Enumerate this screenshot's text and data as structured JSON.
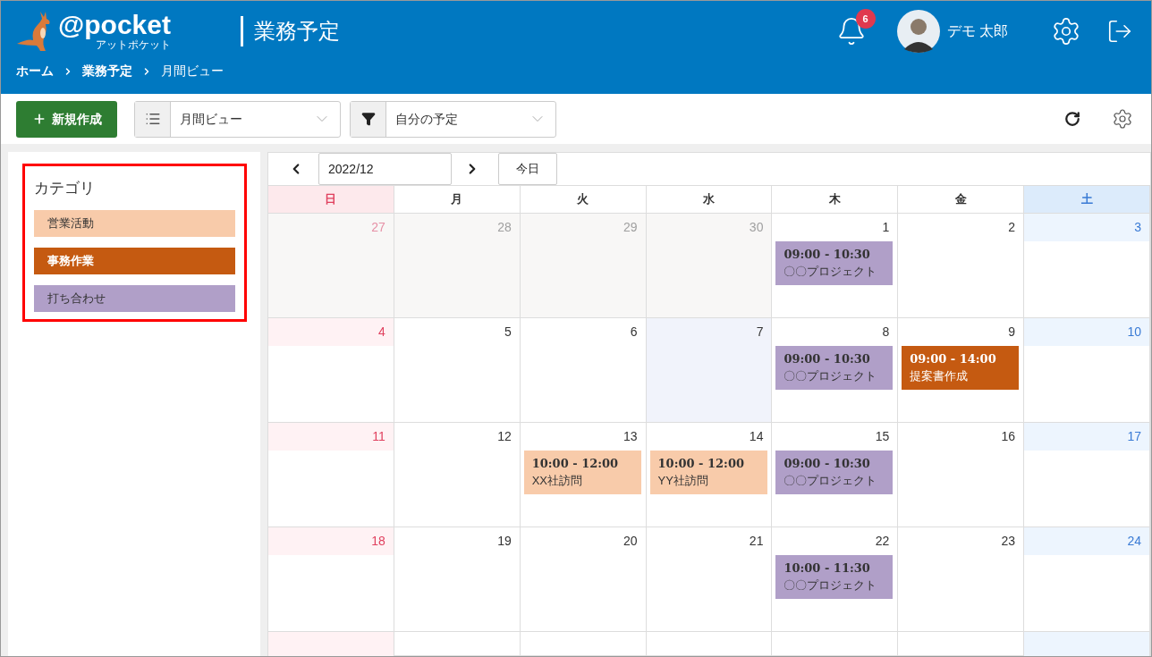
{
  "header": {
    "logo": "@pocket",
    "logo_sub": "アットポケット",
    "title": "業務予定",
    "notification_count": "6",
    "user_name": "デモ 太郎"
  },
  "breadcrumb": [
    "ホーム",
    "業務予定",
    "月間ビュー"
  ],
  "toolbar": {
    "new_button": "新規作成",
    "view_select": "月間ビュー",
    "filter_select": "自分の予定"
  },
  "categories": {
    "title": "カテゴリ",
    "highlighted": true,
    "items": [
      {
        "label": "営業活動",
        "kind": "sales",
        "color": "#f8cbaa"
      },
      {
        "label": "事務作業",
        "kind": "office",
        "color": "#c55a11"
      },
      {
        "label": "打ち合わせ",
        "kind": "meeting",
        "color": "#b09fc8"
      }
    ]
  },
  "calendar": {
    "month": "2022/12",
    "today_button": "今日",
    "weekdays": [
      {
        "label": "日",
        "kind": "sunday"
      },
      {
        "label": "月",
        "kind": "weekday"
      },
      {
        "label": "火",
        "kind": "weekday"
      },
      {
        "label": "水",
        "kind": "weekday"
      },
      {
        "label": "木",
        "kind": "weekday"
      },
      {
        "label": "金",
        "kind": "weekday"
      },
      {
        "label": "土",
        "kind": "saturday"
      }
    ],
    "weeks": [
      [
        {
          "day": "27",
          "outside": true,
          "today": false
        },
        {
          "day": "28",
          "outside": true,
          "today": false
        },
        {
          "day": "29",
          "outside": true,
          "today": false
        },
        {
          "day": "30",
          "outside": true,
          "today": false
        },
        {
          "day": "1",
          "outside": false,
          "today": false,
          "events": [
            {
              "time": "09:00 - 10:30",
              "title": "〇〇プロジェクト",
              "kind": "meeting"
            }
          ]
        },
        {
          "day": "2",
          "outside": false,
          "today": false
        },
        {
          "day": "3",
          "outside": false,
          "today": false
        }
      ],
      [
        {
          "day": "4",
          "outside": false,
          "today": false
        },
        {
          "day": "5",
          "outside": false,
          "today": false
        },
        {
          "day": "6",
          "outside": false,
          "today": false
        },
        {
          "day": "7",
          "outside": false,
          "today": true
        },
        {
          "day": "8",
          "outside": false,
          "today": false,
          "events": [
            {
              "time": "09:00 - 10:30",
              "title": "〇〇プロジェクト",
              "kind": "meeting"
            }
          ]
        },
        {
          "day": "9",
          "outside": false,
          "today": false,
          "events": [
            {
              "time": "09:00 - 14:00",
              "title": "提案書作成",
              "kind": "office"
            }
          ]
        },
        {
          "day": "10",
          "outside": false,
          "today": false
        }
      ],
      [
        {
          "day": "11",
          "outside": false,
          "today": false
        },
        {
          "day": "12",
          "outside": false,
          "today": false
        },
        {
          "day": "13",
          "outside": false,
          "today": false,
          "events": [
            {
              "time": "10:00 - 12:00",
              "title": "XX社訪問",
              "kind": "sales"
            }
          ]
        },
        {
          "day": "14",
          "outside": false,
          "today": false,
          "events": [
            {
              "time": "10:00 - 12:00",
              "title": "YY社訪問",
              "kind": "sales"
            }
          ]
        },
        {
          "day": "15",
          "outside": false,
          "today": false,
          "events": [
            {
              "time": "09:00 - 10:30",
              "title": "〇〇プロジェクト",
              "kind": "meeting"
            }
          ]
        },
        {
          "day": "16",
          "outside": false,
          "today": false
        },
        {
          "day": "17",
          "outside": false,
          "today": false
        }
      ],
      [
        {
          "day": "18",
          "outside": false,
          "today": false
        },
        {
          "day": "19",
          "outside": false,
          "today": false
        },
        {
          "day": "20",
          "outside": false,
          "today": false
        },
        {
          "day": "21",
          "outside": false,
          "today": false
        },
        {
          "day": "22",
          "outside": false,
          "today": false,
          "events": [
            {
              "time": "10:00 - 11:30",
              "title": "〇〇プロジェクト",
              "kind": "meeting"
            }
          ]
        },
        {
          "day": "23",
          "outside": false,
          "today": false
        },
        {
          "day": "24",
          "outside": false,
          "today": false
        }
      ]
    ]
  }
}
